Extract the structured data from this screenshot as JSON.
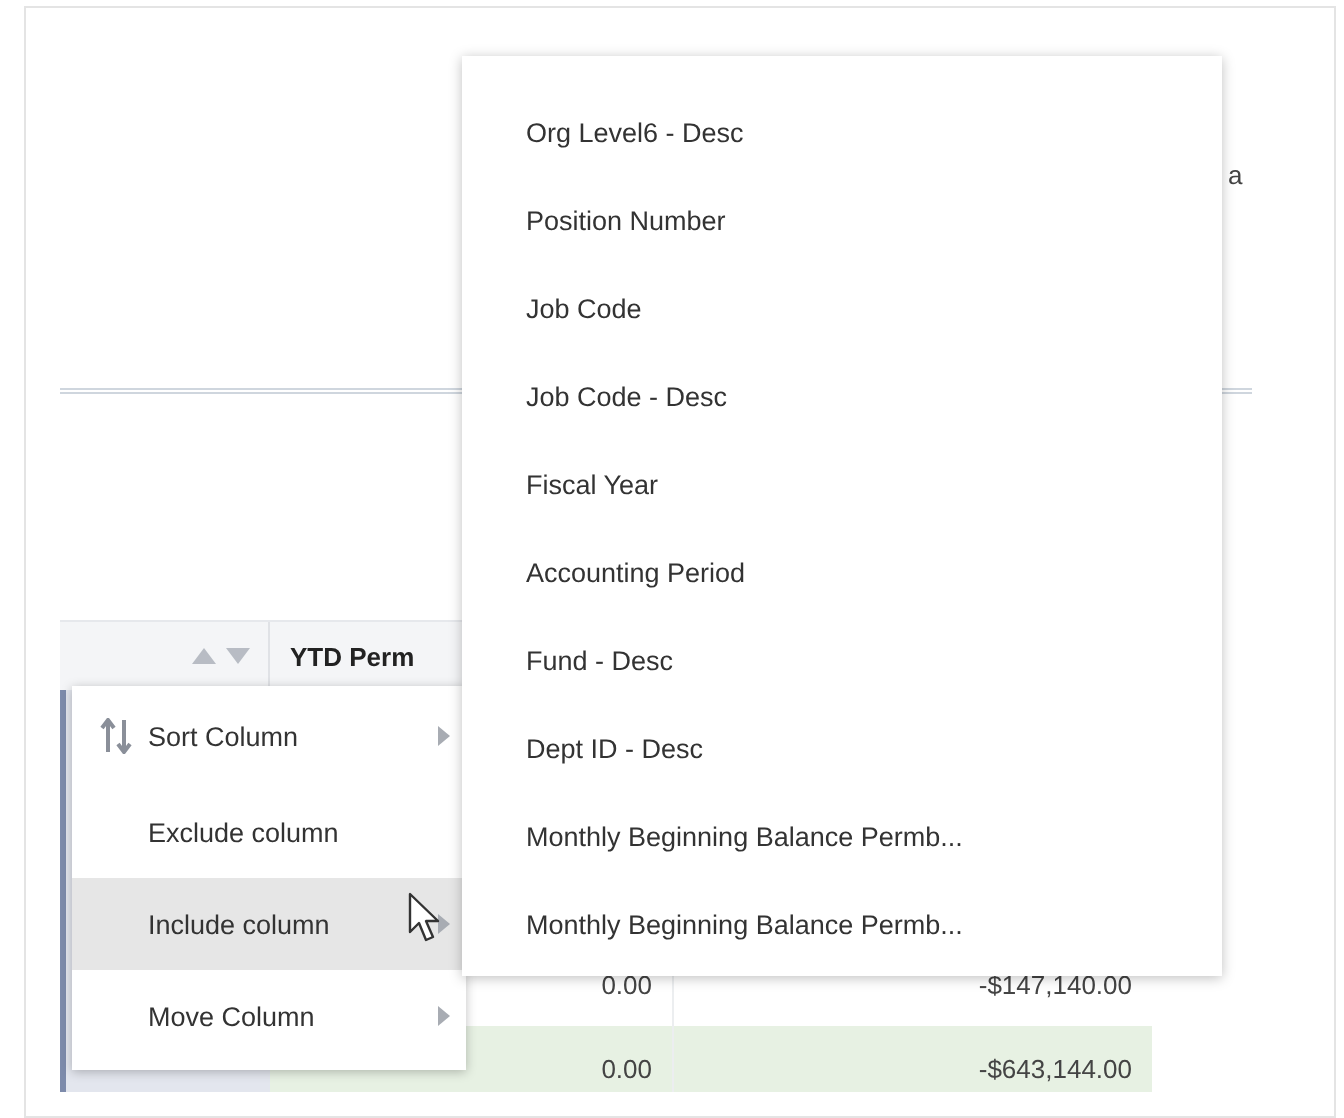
{
  "background_text": "a",
  "table": {
    "header": {
      "label": "YTD Perm"
    },
    "rows": [
      {
        "column_2": "0.00",
        "column_3": "-$147,140.00",
        "highlighted": false
      },
      {
        "column_2": "0.00",
        "column_3": "-$643,144.00",
        "highlighted": true
      }
    ]
  },
  "context_menu": {
    "items": [
      {
        "label": "Sort Column",
        "kind": "sort",
        "has_submenu": true,
        "selected": false
      },
      {
        "label": "Exclude column",
        "kind": "plain",
        "has_submenu": false,
        "selected": false
      },
      {
        "label": "Include column",
        "kind": "plain",
        "has_submenu": true,
        "selected": true
      },
      {
        "label": "Move Column",
        "kind": "plain",
        "has_submenu": true,
        "selected": false
      }
    ]
  },
  "submenu": {
    "items": [
      {
        "label": "Org Level6 - Desc"
      },
      {
        "label": "Position Number"
      },
      {
        "label": "Job Code"
      },
      {
        "label": "Job Code - Desc"
      },
      {
        "label": "Fiscal Year"
      },
      {
        "label": "Accounting Period"
      },
      {
        "label": "Fund - Desc"
      },
      {
        "label": "Dept ID - Desc"
      },
      {
        "label": "Monthly Beginning Balance Permb..."
      },
      {
        "label": "Monthly Beginning Balance Permb..."
      }
    ]
  }
}
